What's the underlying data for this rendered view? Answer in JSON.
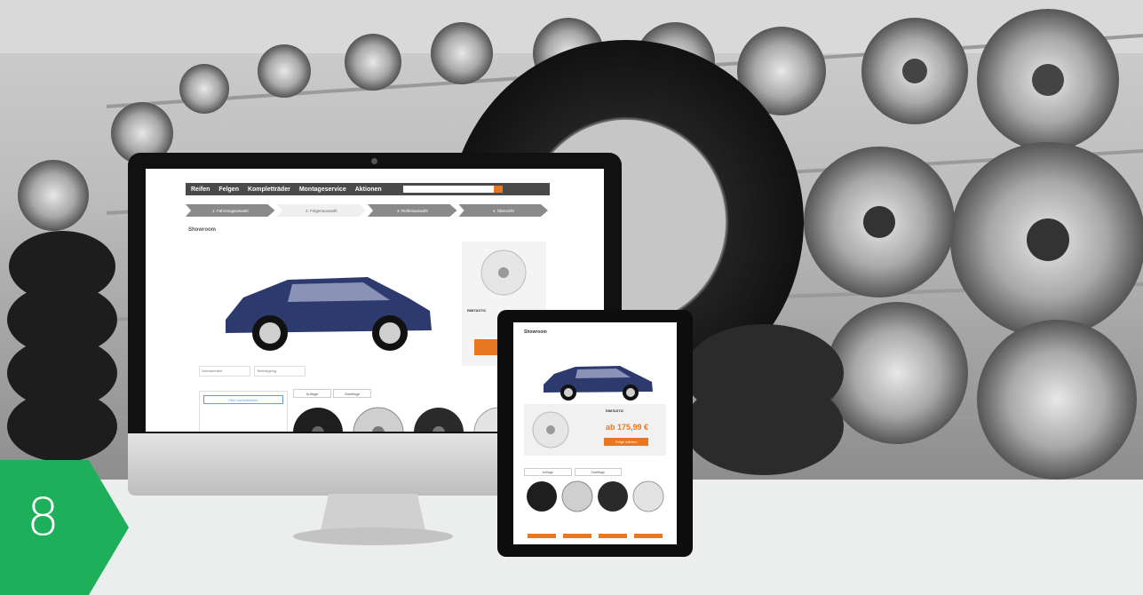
{
  "badge": {
    "number": "8",
    "color": "#1daf5a"
  },
  "monitor": {
    "nav": [
      "Reifen",
      "Felgen",
      "Kompletträder",
      "Montageservice",
      "Aktionen"
    ],
    "steps": [
      "1. Fahrzeugauswahl",
      "2. Felgenauswahl",
      "3. Reifenauswahl",
      "4. Übersicht"
    ],
    "active_step": 1,
    "page_title": "Showroom",
    "filters": [
      "Gebrauchtes",
      "Tieferlegung"
    ],
    "left_panel_button": "Filter zurücksetzen",
    "tabs": [
      "Auflage",
      "Zweiflage"
    ],
    "brand_label": "RIMTASTIC",
    "accent": "#e87722"
  },
  "tablet": {
    "page_title": "Showroom",
    "brand_label": "RIMTASTIC",
    "price": "ab 175,99 €",
    "cta_label": "Felge wählen",
    "tabs": [
      "Auflage",
      "Zweiflage"
    ],
    "accent": "#e87722"
  },
  "icons": [
    "search-icon",
    "home-icon",
    "wheel-icon",
    "tire-icon",
    "list-icon",
    "camera-icon"
  ]
}
